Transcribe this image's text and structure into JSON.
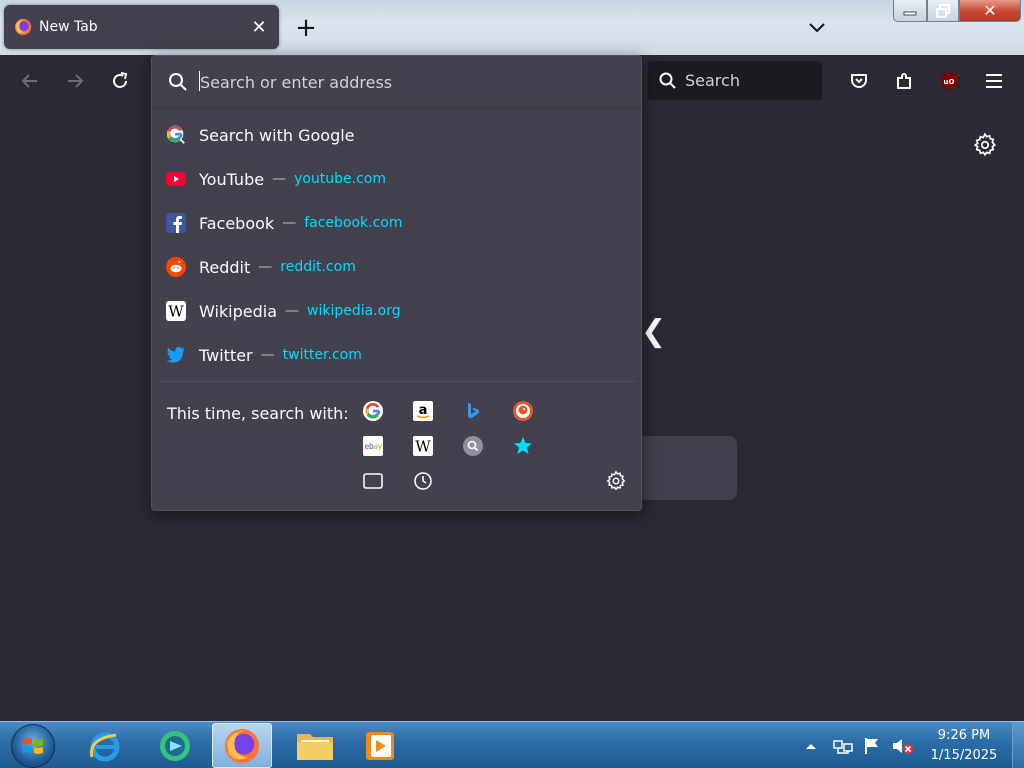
{
  "browser": {
    "tab": {
      "title": "New Tab",
      "close_glyph": "✕"
    },
    "new_tab_glyph": "+",
    "window_controls": {
      "close_glyph": "✕"
    },
    "search_box": {
      "placeholder": "Search"
    }
  },
  "urlbar": {
    "placeholder": "Search or enter address",
    "results": [
      {
        "title": "Search with Google",
        "url": "",
        "icon": "google-icon"
      },
      {
        "title": "YouTube",
        "url": "youtube.com",
        "icon": "youtube-icon",
        "color": "#ff0033"
      },
      {
        "title": "Facebook",
        "url": "facebook.com",
        "icon": "facebook-icon",
        "color": "#3b5998"
      },
      {
        "title": "Reddit",
        "url": "reddit.com",
        "icon": "reddit-icon",
        "color": "#ff4500"
      },
      {
        "title": "Wikipedia",
        "url": "wikipedia.org",
        "icon": "wikipedia-icon",
        "color": "#ffffff"
      },
      {
        "title": "Twitter",
        "url": "twitter.com",
        "icon": "twitter-icon",
        "color": "#1d9bf0"
      }
    ],
    "dash": "—",
    "one_off_label": "This time, search with:",
    "one_off_engines": [
      "google",
      "amazon",
      "bing",
      "duckduckgo",
      "ebay",
      "wikipedia",
      "search-engine",
      "bookmarks",
      "tabs",
      "history",
      "settings"
    ],
    "url_color": "#00ddff"
  },
  "page": {
    "logo_fragment": "❮"
  },
  "taskbar": {
    "time": "9:26 PM",
    "date": "1/15/2025",
    "pinned": [
      "internet-explorer",
      "bluestacks",
      "firefox",
      "file-explorer",
      "media-player"
    ]
  }
}
